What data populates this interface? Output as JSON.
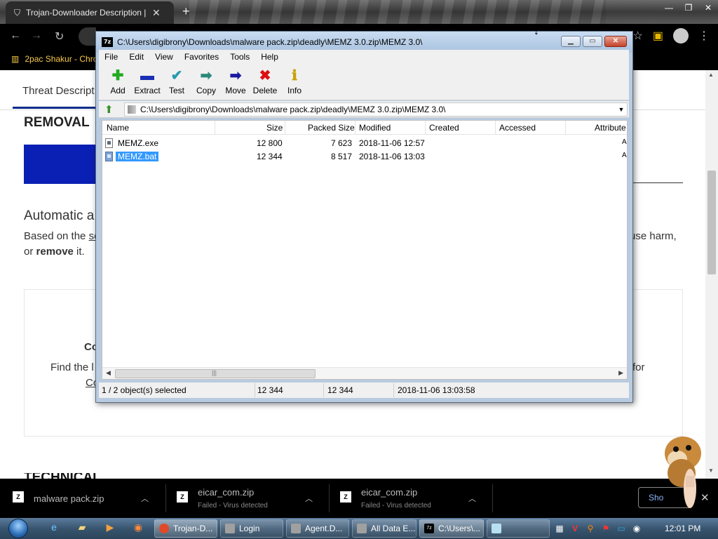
{
  "browser": {
    "tab_title": "Trojan-Downloader Description |",
    "tab_close": "✕",
    "new_tab": "+",
    "bookmark_label": "2pac Shakur - Chro"
  },
  "webpage": {
    "nav_tab": "Threat Descript",
    "removal_heading": "REMOVAL",
    "auto_heading": "Automatic a",
    "based_prefix": "Based on the ",
    "based_link": "se",
    "harm_text": "use harm,",
    "remove_prefix": "or ",
    "remove_bold": "remove",
    "remove_suffix": " it.",
    "card_title_frag": "Co",
    "card_find_frag": "Find the l",
    "card_link_frag": "Co",
    "card_for_frag": "for",
    "tech_frag": "TECHNICAL DETAILS"
  },
  "zip": {
    "title": "C:\\Users\\digibrony\\Downloads\\malware pack.zip\\deadly\\MEMZ 3.0.zip\\MEMZ 3.0\\",
    "app_icon": "7z",
    "menu": [
      "File",
      "Edit",
      "View",
      "Favorites",
      "Tools",
      "Help"
    ],
    "toolbar": [
      {
        "label": "Add",
        "icon": "add-icon",
        "glyph": "✚",
        "color": "#22aa22"
      },
      {
        "label": "Extract",
        "icon": "extract-icon",
        "glyph": "▬",
        "color": "#1a2fb8"
      },
      {
        "label": "Test",
        "icon": "test-icon",
        "glyph": "✔",
        "color": "#2a9ab0"
      },
      {
        "label": "Copy",
        "icon": "copy-icon",
        "glyph": "➡",
        "color": "#2a8a7a"
      },
      {
        "label": "Move",
        "icon": "move-icon",
        "glyph": "➡",
        "color": "#1a1aa0"
      },
      {
        "label": "Delete",
        "icon": "delete-icon",
        "glyph": "✖",
        "color": "#dd1111"
      },
      {
        "label": "Info",
        "icon": "info-icon",
        "glyph": "ℹ",
        "color": "#c8a000"
      }
    ],
    "address": "C:\\Users\\digibrony\\Downloads\\malware pack.zip\\deadly\\MEMZ 3.0.zip\\MEMZ 3.0\\",
    "columns": {
      "name": "Name",
      "size": "Size",
      "packed": "Packed Size",
      "modified": "Modified",
      "created": "Created",
      "accessed": "Accessed",
      "attributes": "Attribute"
    },
    "files": [
      {
        "name": "MEMZ.exe",
        "size": "12 800",
        "packed": "7 623",
        "modified": "2018-11-06 12:57",
        "selected": false
      },
      {
        "name": "MEMZ.bat",
        "size": "12 344",
        "packed": "8 517",
        "modified": "2018-11-06 13:03",
        "selected": true
      }
    ],
    "status": {
      "selection": "1 / 2 object(s) selected",
      "size": "12 344",
      "packed": "12 344",
      "modified": "2018-11-06 13:03:58"
    }
  },
  "downloads": [
    {
      "name": "malware pack.zip",
      "status": ""
    },
    {
      "name": "eicar_com.zip",
      "status": "Failed - Virus detected"
    },
    {
      "name": "eicar_com.zip",
      "status": "Failed - Virus detected"
    }
  ],
  "show_all": "Sho",
  "taskbar": {
    "buttons": [
      {
        "label": "Trojan-D...",
        "color": "#e04a2a"
      },
      {
        "label": "Login",
        "color": "#a0a0a0"
      },
      {
        "label": "Agent.D...",
        "color": "#a0a0a0"
      },
      {
        "label": "All Data E...",
        "color": "#a0a0a0"
      },
      {
        "label": "C:\\Users\\...",
        "color": "#000000"
      }
    ],
    "clock": "12:01 PM"
  }
}
